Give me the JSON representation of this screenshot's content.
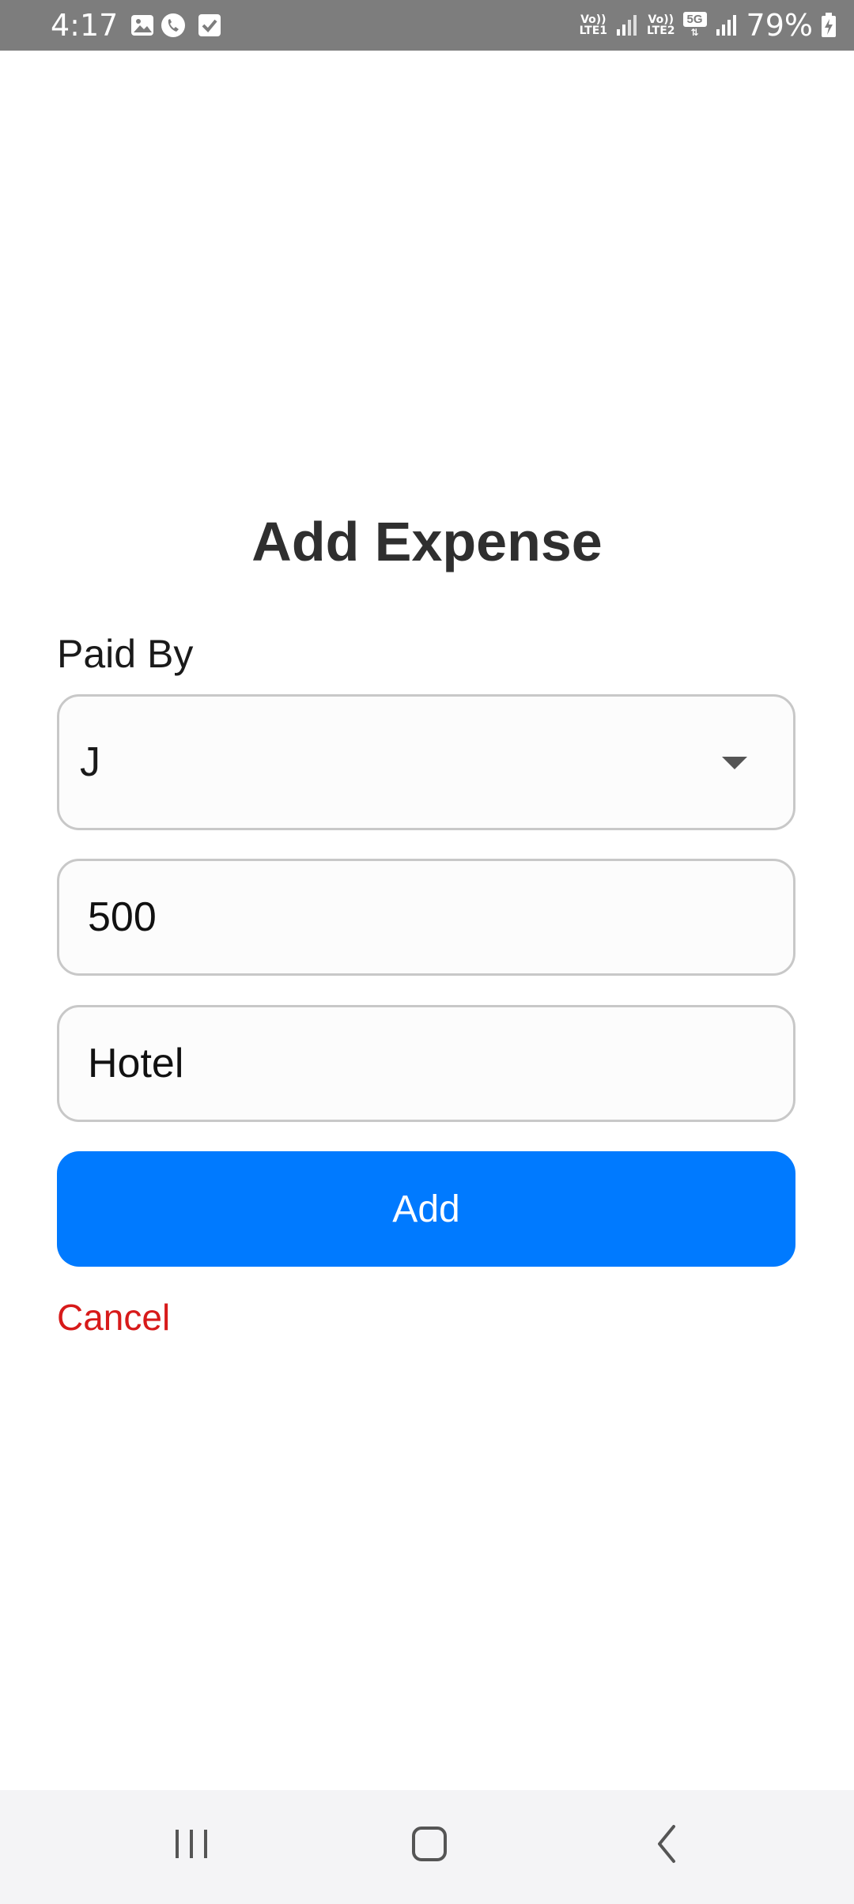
{
  "status_bar": {
    "time": "4:17",
    "sim1_top": "Vo))",
    "sim1_bottom": "LTE1",
    "sim2_top": "Vo))",
    "sim2_bottom": "LTE2",
    "network": "5G",
    "battery": "79%",
    "icons": [
      "gallery-icon",
      "phone-call-icon",
      "checkbox-icon",
      "signal-icon",
      "battery-charging-icon"
    ]
  },
  "form": {
    "title": "Add Expense",
    "paid_by_label": "Paid By",
    "paid_by_value": "J",
    "amount_value": "500",
    "description_value": "Hotel",
    "add_label": "Add",
    "cancel_label": "Cancel"
  },
  "colors": {
    "accent": "#007aff",
    "cancel": "#d71a1a",
    "status_bar": "#7d7d7d"
  },
  "nav_bar": {
    "icons": [
      "recent-apps-icon",
      "home-icon",
      "back-icon"
    ]
  }
}
